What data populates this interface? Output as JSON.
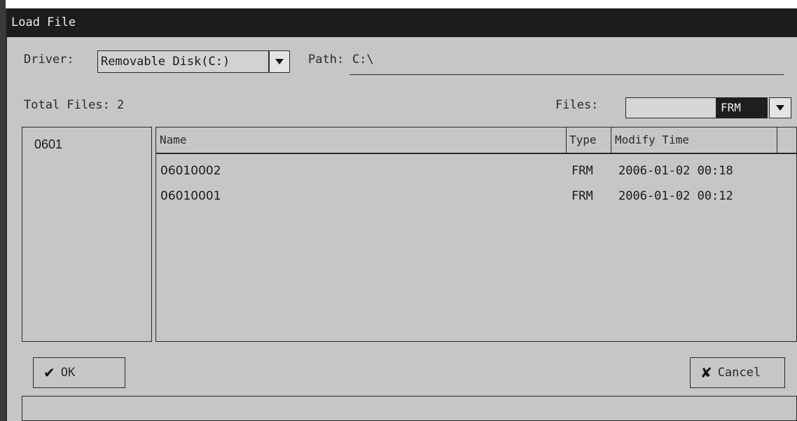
{
  "window": {
    "title": "Load File"
  },
  "driver": {
    "label": "Driver:",
    "value": "Removable Disk(C:)"
  },
  "path": {
    "label": "Path:",
    "value": "C:\\"
  },
  "total_files": {
    "text": "Total Files: 2"
  },
  "filter": {
    "label": "Files:",
    "input_value": "",
    "extension": "FRM"
  },
  "folders": [
    "0601"
  ],
  "file_list": {
    "columns": [
      "Name",
      "Type",
      "Modify Time"
    ],
    "rows": [
      {
        "name": "06010002",
        "type": "FRM",
        "modified": "2006-01-02 00:18"
      },
      {
        "name": "06010001",
        "type": "FRM",
        "modified": "2006-01-02 00:12"
      }
    ]
  },
  "buttons": {
    "ok": {
      "label": "OK",
      "icon": "check-icon"
    },
    "cancel": {
      "label": "Cancel",
      "icon": "x-icon"
    }
  }
}
